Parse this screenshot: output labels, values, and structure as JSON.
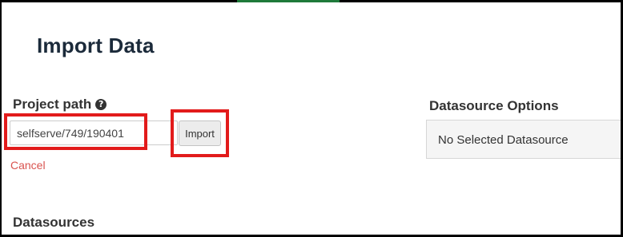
{
  "page": {
    "title": "Import Data"
  },
  "project_path": {
    "label": "Project path",
    "help_icon": "question-circle-icon",
    "value": "selfserve/749/190401",
    "import_label": "Import",
    "cancel_label": "Cancel"
  },
  "datasource_options": {
    "title": "Datasource Options",
    "empty_text": "No Selected Datasource"
  },
  "datasources": {
    "title": "Datasources"
  },
  "colors": {
    "highlight": "#e21b1b",
    "cancel": "#d9534f",
    "accent": "#1f7a3a"
  }
}
